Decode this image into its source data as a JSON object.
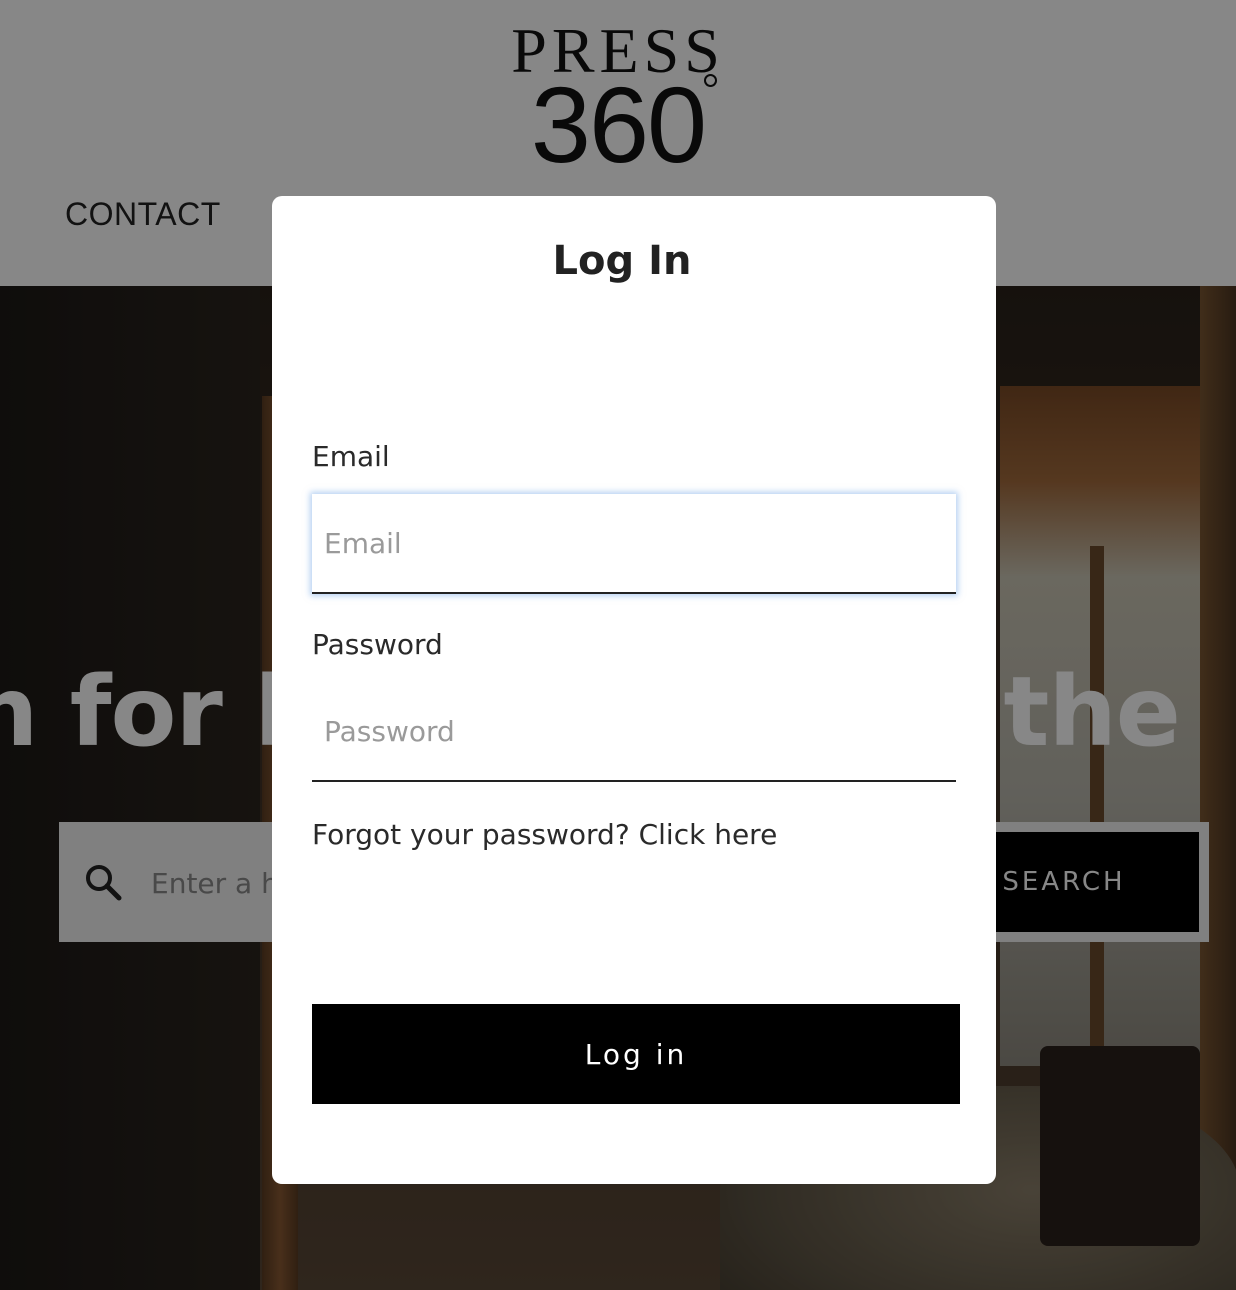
{
  "header": {
    "logo": {
      "line1": "PRESS",
      "line2": "360"
    },
    "nav": {
      "contact": "CONTACT"
    }
  },
  "hero": {
    "headline": "n for hotel stays in the",
    "search": {
      "placeholder": "Enter a hotel name",
      "button_label": "SEARCH"
    }
  },
  "modal": {
    "title": "Log In",
    "email": {
      "label": "Email",
      "placeholder": "Email",
      "value": ""
    },
    "password": {
      "label": "Password",
      "placeholder": "Password",
      "value": ""
    },
    "forgot_text": "Forgot your password? Click here",
    "submit_label": "Log in"
  },
  "colors": {
    "button_bg": "#000000",
    "focus_glow": "#78aae6",
    "overlay": "rgba(0,0,0,0.47)"
  }
}
